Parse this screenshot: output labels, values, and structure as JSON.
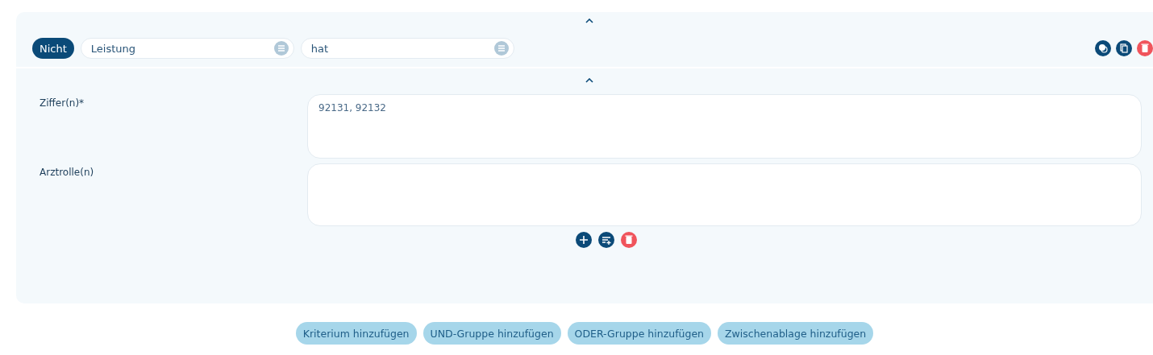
{
  "criterion": {
    "negate": {
      "label": "Nicht",
      "selected": true
    },
    "selects": [
      {
        "value": "Leistung"
      },
      {
        "value": "hat"
      }
    ],
    "fields": [
      {
        "label": "Ziffer(n)*",
        "value": "92131, 92132"
      },
      {
        "label": "Arztrolle(n)"
      }
    ]
  },
  "buttons": [
    "Kriterium hinzufügen",
    "UND-Gruppe hinzufügen",
    "ODER-Gruppe hinzufügen",
    "Zwischenablage hinzufügen"
  ]
}
